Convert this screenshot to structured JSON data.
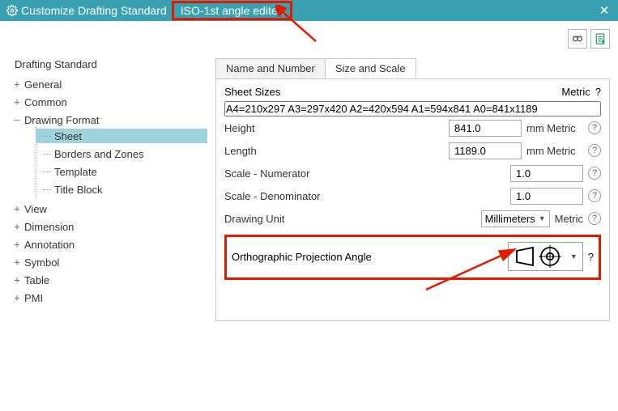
{
  "window": {
    "title": "Customize Drafting Standard",
    "subtitle": "ISO-1st angle edited"
  },
  "leftPanel": {
    "heading": "Drafting Standard",
    "tree": {
      "general": "General",
      "common": "Common",
      "drawingFormat": "Drawing Format",
      "drawingFormat_children": {
        "sheet": "Sheet",
        "bordersZones": "Borders and Zones",
        "template": "Template",
        "titleBlock": "Title Block"
      },
      "view": "View",
      "dimension": "Dimension",
      "annotation": "Annotation",
      "symbol": "Symbol",
      "table": "Table",
      "pmi": "PMI"
    }
  },
  "tabs": {
    "nameNumber": "Name and Number",
    "sizeScale": "Size and Scale"
  },
  "fields": {
    "sheetSizesLabel": "Sheet Sizes",
    "sheetSizesValue": "A4=210x297 A3=297x420 A2=420x594 A1=594x841 A0=841x1189",
    "heightLabel": "Height",
    "heightValue": "841.0",
    "heightUnit": "mm Metric",
    "lengthLabel": "Length",
    "lengthValue": "1189.0",
    "lengthUnit": "mm Metric",
    "scaleNumLabel": "Scale - Numerator",
    "scaleNumValue": "1.0",
    "scaleDenLabel": "Scale - Denominator",
    "scaleDenValue": "1.0",
    "drawingUnitLabel": "Drawing Unit",
    "drawingUnitValue": "Millimeters",
    "drawingUnitSuffix": "Metric",
    "orthoLabel": "Orthographic Projection Angle",
    "metricText": "Metric"
  }
}
